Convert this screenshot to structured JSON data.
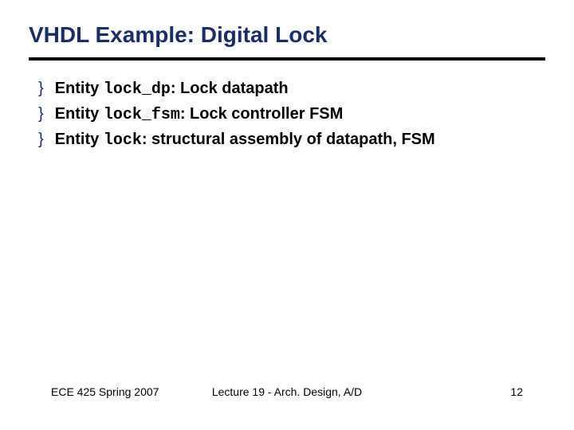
{
  "title": "VHDL Example: Digital Lock",
  "bullets": [
    {
      "prefix": "Entity ",
      "code": "lock_dp",
      "suffix": ": Lock datapath"
    },
    {
      "prefix": "Entity ",
      "code": "lock_fsm",
      "suffix": ": Lock controller FSM"
    },
    {
      "prefix": "Entity ",
      "code": "lock",
      "suffix": ": structural assembly of datapath, FSM"
    }
  ],
  "footer": {
    "left": "ECE 425 Spring 2007",
    "center": "Lecture 19 - Arch. Design, A/D",
    "right": "12"
  }
}
